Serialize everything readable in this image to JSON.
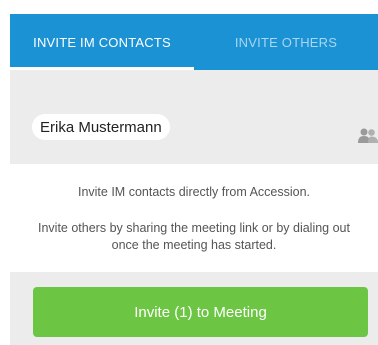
{
  "tabs": [
    {
      "label": "INVITE IM CONTACTS",
      "active": true
    },
    {
      "label": "INVITE OTHERS",
      "active": false
    }
  ],
  "recipients": {
    "chip_label": "Erika Mustermann",
    "contacts_icon": "contacts-icon"
  },
  "info": {
    "line1": "Invite IM contacts directly from Accession.",
    "line2": "Invite others by sharing the meeting link or by dialing out once the meeting has started."
  },
  "actions": {
    "invite_label": "Invite (1) to Meeting"
  },
  "colors": {
    "tabbar": "#1a92d4",
    "tab_inactive_text": "#a9d6f2",
    "panel_gray": "#ececec",
    "button_green": "#6cc644"
  }
}
